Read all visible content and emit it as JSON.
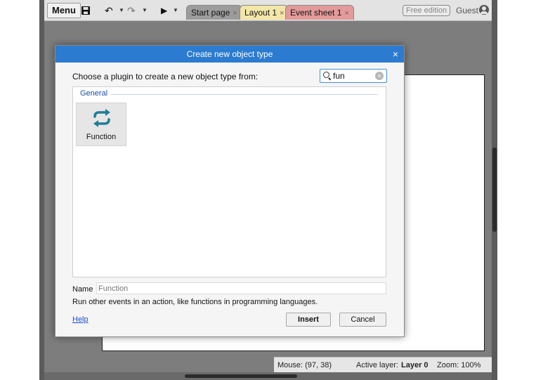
{
  "toolbar": {
    "menu_label": "Menu",
    "save_icon": "floppy-disk-icon",
    "undo_icon": "undo-icon",
    "redo_icon": "redo-icon",
    "play_icon": "play-icon",
    "tabs": [
      {
        "label": "Start page",
        "close": "×",
        "color": "#9c9c9c"
      },
      {
        "label": "Layout 1",
        "close": "×",
        "color": "#f3e6a8"
      },
      {
        "label": "Event sheet 1",
        "close": "×",
        "color": "#e39a9a"
      }
    ],
    "edition_badge": "Free edition",
    "user_label": "Guest"
  },
  "dialog": {
    "title": "Create new object type",
    "close": "×",
    "prompt": "Choose a plugin to create a new object type from:",
    "search": {
      "value": "fun",
      "clear": "×"
    },
    "group_header": "General",
    "plugins": [
      {
        "label": "Function",
        "icon": "function-arrows-icon",
        "icon_color": "#1f7f96"
      }
    ],
    "name_label": "Name",
    "name_placeholder": "Function",
    "description": "Run other events in an action, like functions in programming languages.",
    "help_link": "Help",
    "insert_label": "Insert",
    "cancel_label": "Cancel",
    "accent_color": "#2b7bd0"
  },
  "statusbar": {
    "mouse": "Mouse: (97, 38)",
    "active_layer_label": "Active layer:",
    "active_layer_value": "Layer 0",
    "zoom": "Zoom: 100%"
  }
}
